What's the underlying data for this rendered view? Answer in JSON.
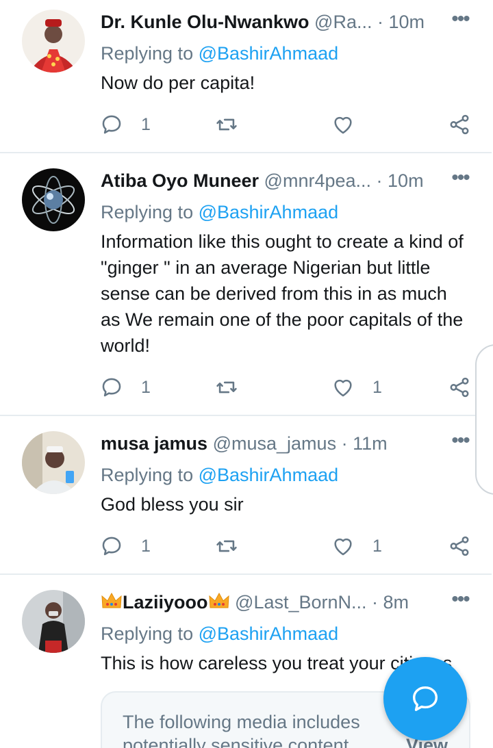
{
  "tweets": [
    {
      "name": "Dr. Kunle Olu-Nwankwo",
      "handle": "@Ra...",
      "time": "· 10m",
      "replying_prefix": "Replying to",
      "replying_to": "@BashirAhmaad",
      "text": "Now do per capita!",
      "replies": "1",
      "retweets": "",
      "likes": ""
    },
    {
      "name": "Atiba Oyo Muneer",
      "handle": "@mnr4pea...",
      "time": "· 10m",
      "replying_prefix": "Replying to",
      "replying_to": "@BashirAhmaad",
      "text": "Information like this ought to create a kind of \"ginger \" in an average Nigerian but little sense can be derived from this in as much as We remain one of the poor capitals of the world!",
      "replies": "1",
      "retweets": "",
      "likes": "1"
    },
    {
      "name": "musa jamus",
      "handle": "@musa_jamus",
      "time": "· 11m",
      "replying_prefix": "Replying to",
      "replying_to": "@BashirAhmaad",
      "text": "God bless you sir",
      "replies": "1",
      "retweets": "",
      "likes": "1"
    },
    {
      "name": "Laziiyooo",
      "handle": "@Last_BornN...",
      "time": "· 8m",
      "replying_prefix": "Replying to",
      "replying_to": "@BashirAhmaad",
      "text": "This is how careless you treat your citizens",
      "name_decoration": "crown-emoji"
    }
  ],
  "media_warning": {
    "text": "The following media includes potentially sensitive content",
    "view_label": "View"
  },
  "icons": {
    "reply": "reply-icon",
    "retweet": "retweet-icon",
    "like": "heart-icon",
    "share": "share-icon",
    "more": "more-options-icon",
    "compose": "compose-reply-icon"
  },
  "colors": {
    "accent": "#1da1f2",
    "secondary_text": "#657786",
    "divider": "#e6ecf0"
  }
}
